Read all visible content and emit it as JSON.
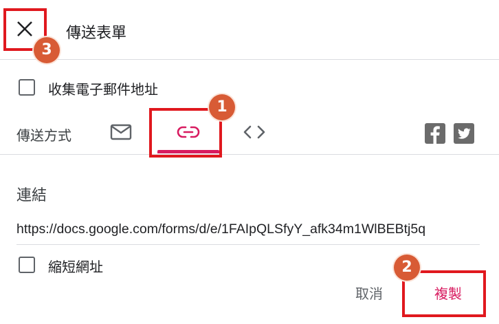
{
  "dialog": {
    "title": "傳送表單",
    "collect_email_label": "收集電子郵件地址",
    "send_via_label": "傳送方式",
    "link_section_title": "連結",
    "url": "https://docs.google.com/forms/d/e/1FAIpQLSfyY_afk34m1WlBEBtj5q",
    "shorten_url_label": "縮短網址",
    "cancel_label": "取消",
    "copy_label": "複製"
  },
  "tabs": [
    {
      "name": "email",
      "icon": "envelope-icon",
      "selected": false
    },
    {
      "name": "link",
      "icon": "link-icon",
      "selected": true
    },
    {
      "name": "embed",
      "icon": "code-icon",
      "selected": false
    }
  ],
  "social": [
    "facebook-icon",
    "twitter-icon"
  ],
  "annotations": [
    {
      "number": "1",
      "target": "link-tab"
    },
    {
      "number": "2",
      "target": "copy-button"
    },
    {
      "number": "3",
      "target": "close-button"
    }
  ],
  "colors": {
    "accent": "#d81b60",
    "annotation_box": "#e0181e",
    "annotation_badge": "#d85b35",
    "divider": "#dadce0"
  }
}
